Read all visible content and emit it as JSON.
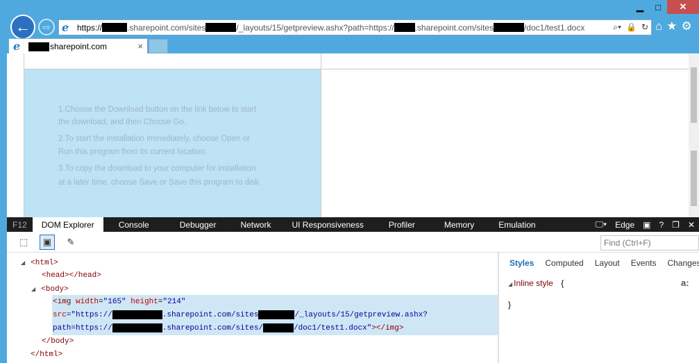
{
  "window": {
    "minimize": "▁",
    "maximize": "□",
    "close": "✕"
  },
  "nav": {
    "back_icon": "←",
    "forward_icon": "⇨"
  },
  "address": {
    "part1": "https://",
    "part2": ".sharepoint.com/sites",
    "part3": "/_layouts/15/getpreview.ashx?path=https://",
    "part4": ".sharepoint.com/sites",
    "part5": "/doc1/test1.docx"
  },
  "address_tools": [
    "⌕▾",
    "🔒",
    "↻"
  ],
  "toolbar_icons": [
    "⌂",
    "★",
    "⚙"
  ],
  "tab": {
    "title": "sharepoint.com",
    "close": "×"
  },
  "preview": {
    "lines": [
      "1.Choose the Download button on the link below to start",
      "the download, and then Choose Go.",
      "2.To start the installation immediately, choose Open or",
      "Run this program from its current location.",
      "3.To copy the download to your computer for installation",
      "at a later time, choose Save or Save this program to disk."
    ]
  },
  "devtools": {
    "f12": "F12",
    "tabs": [
      "DOM Explorer",
      "Console",
      "Debugger",
      "Network",
      "UI Responsiveness",
      "Profiler",
      "Memory",
      "Emulation"
    ],
    "mode": "Edge",
    "help": "?",
    "find_placeholder": "Find (Ctrl+F)"
  },
  "dom": {
    "html_open": "<html>",
    "head": "<head></head>",
    "body_open": "<body>",
    "img_tag": "<img",
    "img_width_attr": "width",
    "img_width_val": "\"165\"",
    "img_height_attr": "height",
    "img_height_val": "\"214\"",
    "src_attr": "src",
    "src_val1": "=\"https://",
    "src_val2": ".sharepoint.com/sites",
    "src_val3": "/_layouts/15/getpreview.ashx?",
    "path_val1": "path=https://",
    "path_val2": ".sharepoint.com/sites/",
    "path_val3": "/doc1/test1.docx\"",
    "img_close": "></img>",
    "body_close": "</body>",
    "html_close": "</html>"
  },
  "styles": {
    "tabs": [
      "Styles",
      "Computed",
      "Layout",
      "Events",
      "Changes"
    ],
    "inline_label": "Inline style",
    "open_brace": "{",
    "close_brace": "}",
    "a_icon": "a:"
  }
}
